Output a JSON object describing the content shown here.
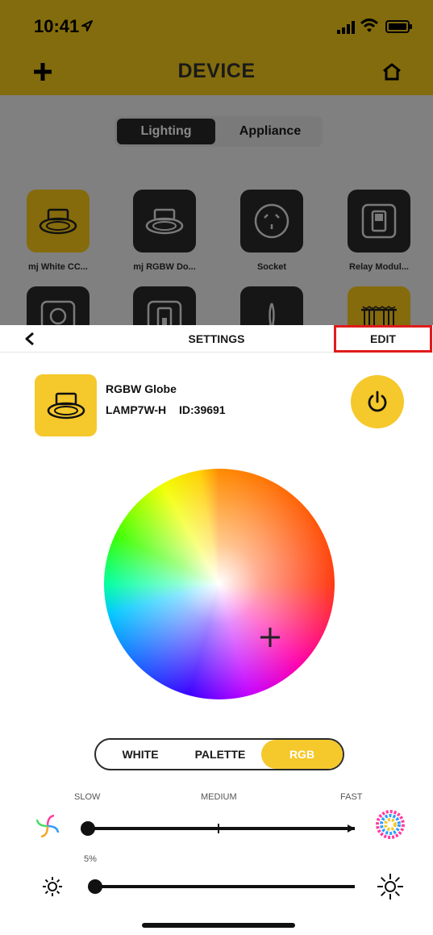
{
  "status": {
    "time": "10:41"
  },
  "nav": {
    "title": "DEVICE"
  },
  "tabs": [
    {
      "label": "Lighting",
      "selected": true
    },
    {
      "label": "Appliance",
      "selected": false
    }
  ],
  "devices": [
    {
      "label": "mj White CC...",
      "icon": "downlight-icon",
      "active": true
    },
    {
      "label": "mj RGBW Do...",
      "icon": "downlight-icon",
      "active": false
    },
    {
      "label": "Socket",
      "icon": "socket-icon",
      "active": false
    },
    {
      "label": "Relay Modul...",
      "icon": "relay-icon",
      "active": false
    },
    {
      "label": "",
      "icon": "globe-icon",
      "active": false
    },
    {
      "label": "",
      "icon": "switch-icon",
      "active": false
    },
    {
      "label": "",
      "icon": "fan-icon",
      "active": false
    },
    {
      "label": "",
      "icon": "curtain-icon",
      "active": true
    }
  ],
  "settings": {
    "title": "SETTINGS",
    "edit_label": "EDIT",
    "device": {
      "name": "RGBW Globe",
      "model": "LAMP7W-H",
      "id": "ID:39691"
    },
    "power": {
      "icon": "power-icon"
    },
    "modes": [
      {
        "label": "WHITE",
        "selected": false
      },
      {
        "label": "PALETTE",
        "selected": false
      },
      {
        "label": "RGB",
        "selected": true
      }
    ],
    "speed": {
      "labels": [
        "SLOW",
        "MEDIUM",
        "FAST"
      ],
      "value": 0
    },
    "brightness": {
      "label": "5%",
      "value": 5
    }
  },
  "colors": {
    "accent": "#f5c82b",
    "highlight": "#e01b1b",
    "dimmed_header": "#836c0d"
  }
}
